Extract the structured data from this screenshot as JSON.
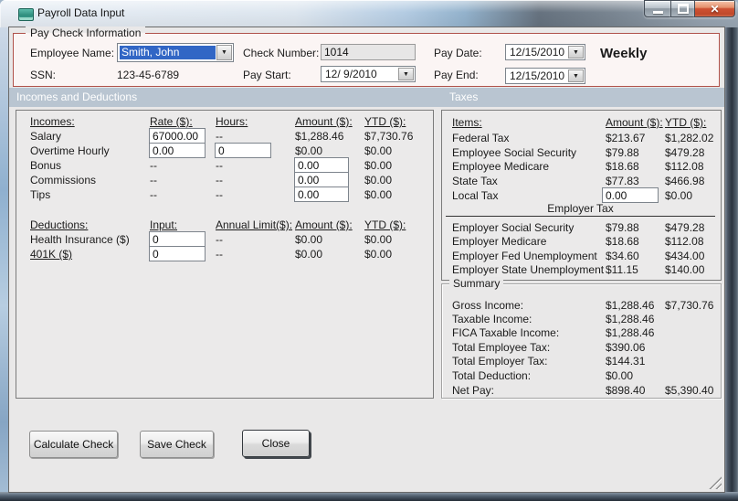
{
  "window": {
    "title": "Payroll Data Input"
  },
  "icons": {
    "dropdown_arrow": "▼",
    "close_glyph": "✕"
  },
  "colors": {
    "group_border": "#b0524a",
    "section_bar": "#b9c5d1",
    "selection_blue": "#3166c5",
    "close_button_red": "#cf5233",
    "client_bg": "#e9e8e8"
  },
  "pay_check_info": {
    "section_label": "Pay Check Information",
    "employee_name_label": "Employee Name:",
    "employee_name_value": "Smith, John",
    "ssn_label": "SSN:",
    "ssn_value": "123-45-6789",
    "check_number_label": "Check Number:",
    "check_number_value": "1014",
    "pay_start_label": "Pay Start:",
    "pay_start_value": "12/ 9/2010",
    "pay_date_label": "Pay Date:",
    "pay_date_value": "12/15/2010",
    "pay_end_label": "Pay End:",
    "pay_end_value": "12/15/2010",
    "frequency": "Weekly"
  },
  "sections": {
    "incomes_and_deductions": "Incomes and Deductions",
    "taxes": "Taxes"
  },
  "incomes": {
    "headers": {
      "item": "Incomes:",
      "rate": "Rate ($):",
      "hours": "Hours:",
      "amount": "Amount ($):",
      "ytd": "YTD ($):"
    },
    "rows": [
      {
        "label": "Salary",
        "rate": "67000.00",
        "hours": "--",
        "amount": "$1,288.46",
        "ytd": "$7,730.76"
      },
      {
        "label": "Overtime Hourly",
        "rate": "0.00",
        "hours": "0",
        "amount": "$0.00",
        "ytd": "$0.00"
      },
      {
        "label": "Bonus",
        "rate": "--",
        "hours": "--",
        "amount": "0.00",
        "ytd": "$0.00"
      },
      {
        "label": "Commissions",
        "rate": "--",
        "hours": "--",
        "amount": "0.00",
        "ytd": "$0.00"
      },
      {
        "label": "Tips",
        "rate": "--",
        "hours": "--",
        "amount": "0.00",
        "ytd": "$0.00"
      }
    ]
  },
  "deductions": {
    "headers": {
      "item": "Deductions:",
      "input": "Input:",
      "limit": "Annual Limit($):",
      "amount": "Amount ($):",
      "ytd": "YTD ($):"
    },
    "rows": [
      {
        "label": "Health Insurance  ($)",
        "input": "0",
        "limit": "--",
        "amount": "$0.00",
        "ytd": "$0.00"
      },
      {
        "label": "401K  ($)",
        "input": "0",
        "limit": "--",
        "amount": "$0.00",
        "ytd": "$0.00"
      }
    ]
  },
  "taxes": {
    "headers": {
      "item": "Items:",
      "amount": "Amount ($):",
      "ytd": "YTD ($):"
    },
    "employee_rows": [
      {
        "label": "Federal Tax",
        "amount": "$213.67",
        "ytd": "$1,282.02"
      },
      {
        "label": "Employee Social Security",
        "amount": "$79.88",
        "ytd": "$479.28"
      },
      {
        "label": "Employee Medicare",
        "amount": "$18.68",
        "ytd": "$112.08"
      },
      {
        "label": "State Tax",
        "amount": "$77.83",
        "ytd": "$466.98"
      },
      {
        "label": "Local Tax",
        "amount": "0.00",
        "ytd": "$0.00"
      }
    ],
    "employer_header": "Employer Tax",
    "employer_rows": [
      {
        "label": "Employer Social Security",
        "amount": "$79.88",
        "ytd": "$479.28"
      },
      {
        "label": "Employer Medicare",
        "amount": "$18.68",
        "ytd": "$112.08"
      },
      {
        "label": "Employer Fed Unemployment",
        "amount": "$34.60",
        "ytd": "$434.00"
      },
      {
        "label": "Employer State Unemployment",
        "amount": "$11.15",
        "ytd": "$140.00"
      }
    ]
  },
  "summary": {
    "section_label": "Summary",
    "rows": [
      {
        "label": "Gross Income:",
        "amount": "$1,288.46",
        "ytd": "$7,730.76"
      },
      {
        "label": "Taxable Income:",
        "amount": "$1,288.46",
        "ytd": ""
      },
      {
        "label": "FICA Taxable Income:",
        "amount": "$1,288.46",
        "ytd": ""
      },
      {
        "label": "Total Employee Tax:",
        "amount": "$390.06",
        "ytd": ""
      },
      {
        "label": "Total Employer Tax:",
        "amount": "$144.31",
        "ytd": ""
      },
      {
        "label": "Total Deduction:",
        "amount": "$0.00",
        "ytd": ""
      },
      {
        "label": "Net Pay:",
        "amount": "$898.40",
        "ytd": "$5,390.40"
      }
    ]
  },
  "buttons": {
    "calculate": "Calculate Check",
    "save": "Save Check",
    "close": "Close"
  }
}
